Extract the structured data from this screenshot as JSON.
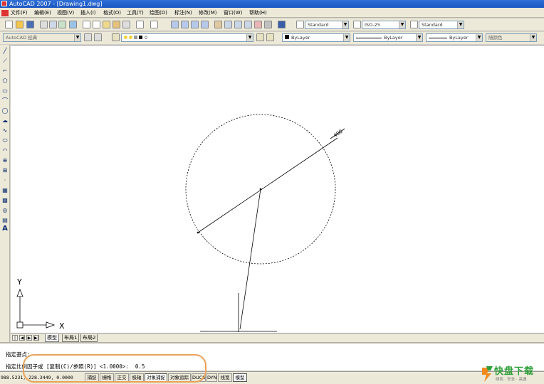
{
  "window": {
    "title": "AutoCAD 2007 - [Drawing1.dwg]"
  },
  "menu": [
    "文件(F)",
    "编辑(E)",
    "视图(V)",
    "插入(I)",
    "格式(O)",
    "工具(T)",
    "绘图(D)",
    "标注(N)",
    "修改(M)",
    "窗口(W)",
    "帮助(H)"
  ],
  "styles": {
    "text_style": "Standard",
    "dim_style": "ISO-25",
    "table_style": "Standard"
  },
  "workspace": "AutoCAD 经典",
  "layer": "0",
  "properties": {
    "color": "ByLayer",
    "linetype": "ByLayer",
    "lineweight": "ByLayer",
    "plotstyle": "随颜色"
  },
  "drawing": {
    "dimension_text": "400",
    "ucs_x": "X",
    "ucs_y": "Y"
  },
  "layout_tabs": [
    "模型",
    "布局1",
    "布局2"
  ],
  "command": {
    "line1": "指定基点:",
    "line2": "指定比例因子或 [复制(C)/参照(R)] <1.0000>:  0.5"
  },
  "status": {
    "coords": "988.5231,  228.3449, 0.0000",
    "buttons": [
      "捕捉",
      "栅格",
      "正交",
      "极轴",
      "对象捕捉",
      "对象追踪",
      "DUCS",
      "DYN",
      "线宽",
      "模型"
    ],
    "active": [
      "对象捕捉",
      "模型"
    ]
  },
  "watermark": {
    "brand": "快盘下载",
    "tagline": "绿色 · 安全 · 高速"
  },
  "colors": {
    "title_blue": "#1b56c2",
    "highlight": "#e8a35a",
    "brand_green": "#2e9e3a",
    "brand_orange": "#f08a1c"
  }
}
